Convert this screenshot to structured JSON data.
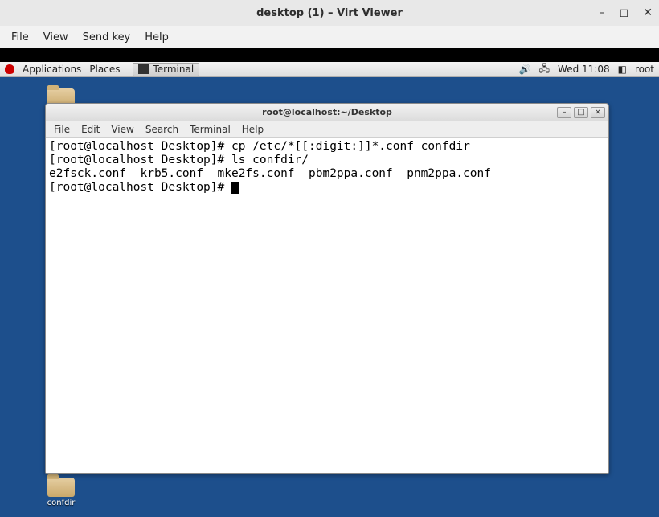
{
  "virtViewer": {
    "title": "desktop (1) – Virt Viewer",
    "minimize": "–",
    "maximize": "◻",
    "close": "✕",
    "menu": {
      "file": "File",
      "view": "View",
      "sendKey": "Send key",
      "help": "Help"
    }
  },
  "gnomePanel": {
    "applications": "Applications",
    "places": "Places",
    "taskTerminal": "Terminal",
    "clock": "Wed 11:08",
    "user": "root",
    "soundIcon": "sound-icon",
    "networkIcon": "network-icon",
    "userIcon": "user-menu-icon"
  },
  "desktop": {
    "folderTop": "",
    "folderBottom": "confdir"
  },
  "terminal": {
    "title": "root@localhost:~/Desktop",
    "minimize": "–",
    "maximize": "□",
    "close": "×",
    "menu": {
      "file": "File",
      "edit": "Edit",
      "view": "View",
      "search": "Search",
      "terminal": "Terminal",
      "help": "Help"
    },
    "lines": {
      "l1_prompt": "[root@localhost Desktop]# ",
      "l1_cmd": "cp /etc/*[[:digit:]]*.conf confdir",
      "l2_prompt": "[root@localhost Desktop]# ",
      "l2_cmd": "ls confdir/",
      "l3_out": "e2fsck.conf  krb5.conf  mke2fs.conf  pbm2ppa.conf  pnm2ppa.conf",
      "l4_prompt": "[root@localhost Desktop]# "
    }
  }
}
